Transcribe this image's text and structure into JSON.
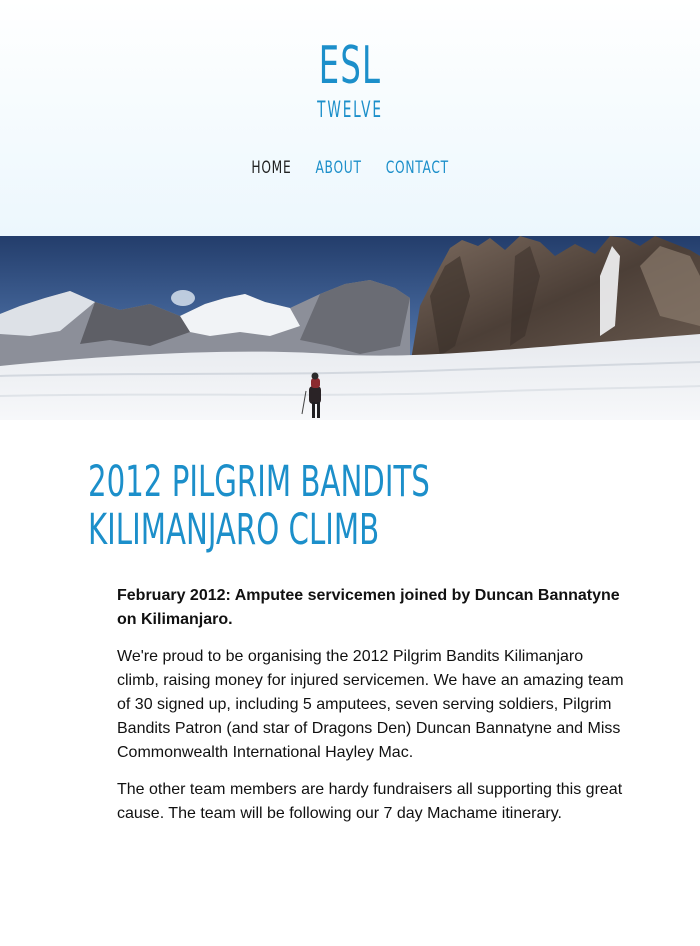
{
  "logo": {
    "main": "ESL",
    "sub": "TWELVE"
  },
  "nav": {
    "items": [
      {
        "label": "HOME",
        "active": true
      },
      {
        "label": "ABOUT",
        "active": false
      },
      {
        "label": "CONTACT",
        "active": false
      }
    ]
  },
  "hero": {
    "image": "panoramic snowy mountain glacier with climber"
  },
  "article": {
    "title_line1": "2012 PILGRIM BANDITS",
    "title_line2": "KILIMANJARO CLIMB",
    "lead": "February 2012: Amputee servicemen joined by Duncan Bannatyne on Kilimanjaro.",
    "paragraph1": "We're proud to be organising the 2012 Pilgrim Bandits Kilimanjaro climb, raising money for injured servicemen. We have an amazing team of 30 signed up, including 5 amputees, seven serving soldiers, Pilgrim Bandits Patron (and star of Dragons Den) Duncan Bannatyne and Miss Commonwealth International Hayley Mac.",
    "paragraph2": "The other team members are hardy fundraisers all supporting this great cause. The team will be following our 7 day Machame itinerary."
  },
  "colors": {
    "accent": "#1c8fca",
    "nav_active": "#222222",
    "header_gradient_bottom": "#ecf7fd"
  }
}
